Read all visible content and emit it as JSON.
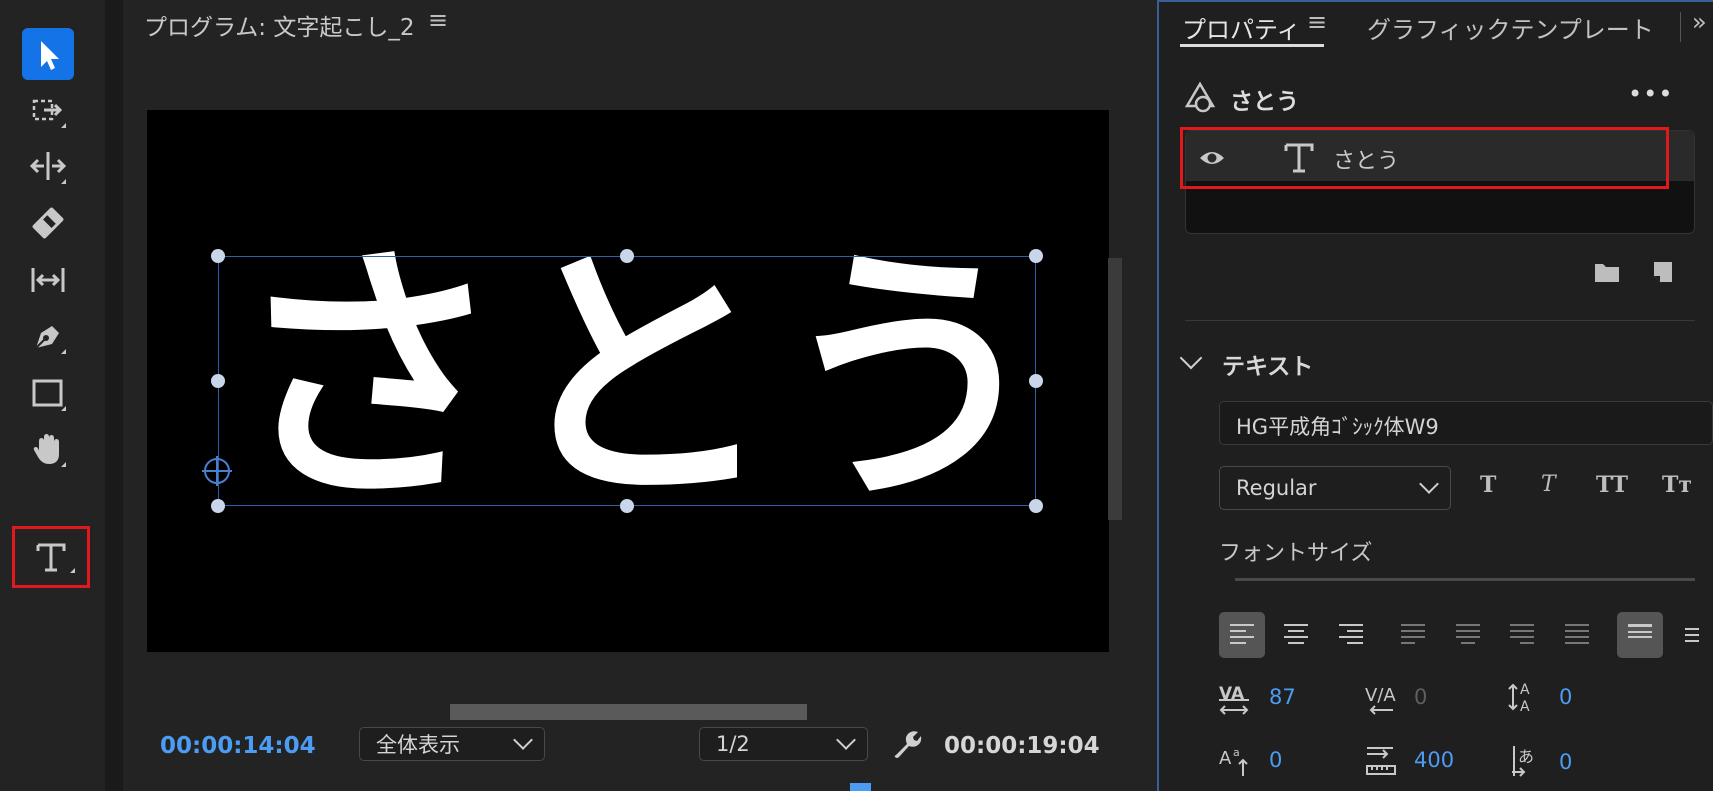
{
  "toolbar": {
    "tools": [
      {
        "name": "selection-tool",
        "icon": "arrow-cursor-icon",
        "active": true
      },
      {
        "name": "track-select-tool",
        "icon": "track-select-icon"
      },
      {
        "name": "ripple-edit-tool",
        "icon": "ripple-edit-icon"
      },
      {
        "name": "razor-tool",
        "icon": "razor-icon"
      },
      {
        "name": "slip-tool",
        "icon": "slip-icon"
      },
      {
        "name": "pen-tool",
        "icon": "pen-icon"
      },
      {
        "name": "rectangle-tool",
        "icon": "rectangle-icon"
      },
      {
        "name": "hand-tool",
        "icon": "hand-icon"
      },
      {
        "name": "type-tool",
        "icon": "type-icon",
        "highlighted": true
      }
    ],
    "accent": "#1473e6",
    "highlight_color": "#e0191d"
  },
  "monitor": {
    "title": "プログラム: 文字起こし_2",
    "menu_glyph": "≡",
    "title_text": "さとう",
    "timecode_current": "00:00:14:04",
    "zoom_select": "全体表示",
    "resolution_select": "1/2",
    "timecode_duration": "00:00:19:04",
    "timecode_color": "#4c9cf3"
  },
  "properties": {
    "tab_properties": "プロパティ",
    "tab_menu_glyph": "≡",
    "tab_templates": "グラフィックテンプレート",
    "tab_more": "»",
    "object_name": "さとう",
    "more_glyph": "•••",
    "layer_name": "さとう",
    "section_title": "テキスト",
    "font_family": "HG平成角ｺﾞｼｯｸ体W9",
    "font_style": "Regular",
    "font_style_buttons": [
      "T",
      "T",
      "TT",
      "Tт"
    ],
    "font_size_label": "フォントサイズ",
    "metrics": {
      "kerning": "87",
      "tracking": "0",
      "leading": "0",
      "baseline_shift": "0",
      "tsume": "400",
      "tab_width": "0"
    }
  }
}
